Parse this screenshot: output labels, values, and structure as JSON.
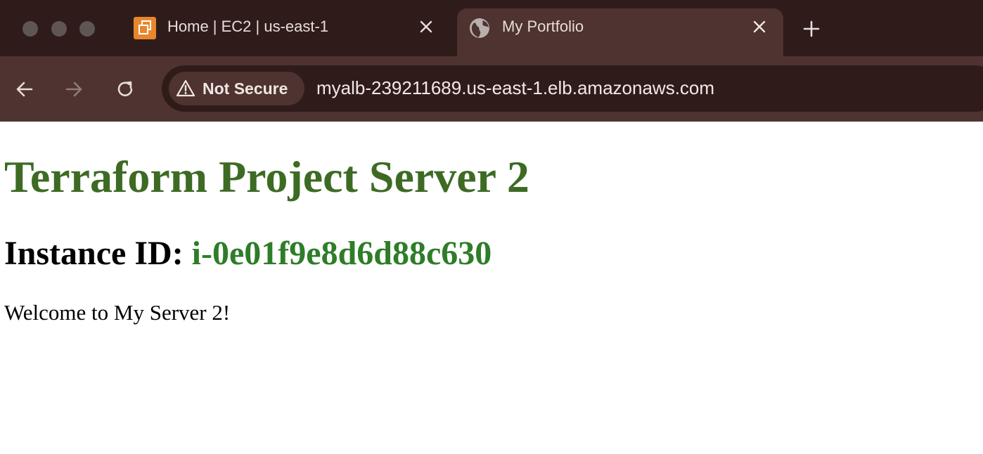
{
  "tabs": [
    {
      "title": "Home | EC2 | us-east-1",
      "favicon": "aws-ec2-icon",
      "active": false
    },
    {
      "title": "My Portfolio",
      "favicon": "globe-icon",
      "active": true
    }
  ],
  "toolbar": {
    "security_label": "Not Secure",
    "url": "myalb-239211689.us-east-1.elb.amazonaws.com"
  },
  "page": {
    "heading": "Terraform Project Server 2",
    "instance_label": "Instance ID:",
    "instance_id": "i-0e01f9e8d6d88c630",
    "welcome": "Welcome to My Server 2!"
  },
  "colors": {
    "tabstrip_bg": "#2f1c1a",
    "toolbar_bg": "#4e3330",
    "heading_green": "#3d6b24",
    "instance_green": "#2e7d28",
    "aws_orange": "#e8862e"
  }
}
